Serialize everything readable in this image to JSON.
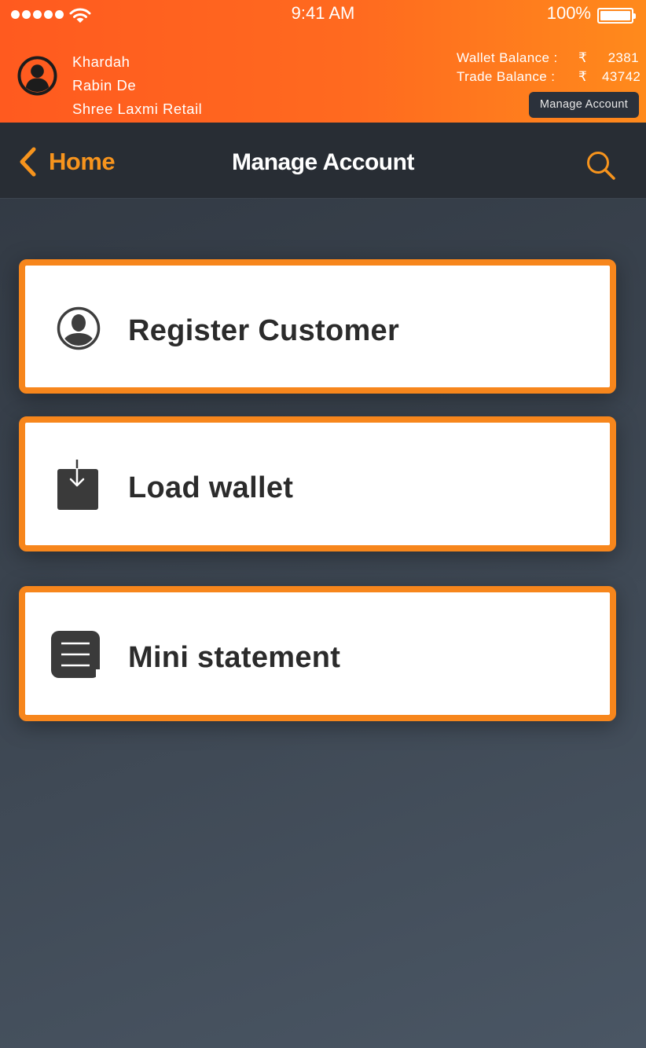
{
  "status_bar": {
    "time": "9:41 AM",
    "battery_percent": "100%"
  },
  "header": {
    "avatar_icon": "user-circle-icon",
    "location": "Khardah",
    "user_name": "Rabin De",
    "shop_name": "Shree Laxmi Retail",
    "wallet_label": "Wallet Balance :",
    "wallet_currency": "₹",
    "wallet_value": "2381",
    "trade_label": "Trade Balance :",
    "trade_currency": "₹",
    "trade_value": "43742",
    "manage_button_label": "Manage Account"
  },
  "nav": {
    "back_label": "Home",
    "title": "Manage Account",
    "search_icon": "search-icon"
  },
  "menu": {
    "items": [
      {
        "label": "Register Customer",
        "icon": "user-silhouette-icon"
      },
      {
        "label": "Load wallet",
        "icon": "download-box-icon"
      },
      {
        "label": "Mini statement",
        "icon": "statement-lines-icon"
      }
    ]
  },
  "colors": {
    "accent_orange": "#f7861c",
    "header_gradient_start": "#ff5a1f",
    "header_gradient_end": "#ff8a1c",
    "nav_background": "#282d34",
    "card_background": "#ffffff"
  }
}
